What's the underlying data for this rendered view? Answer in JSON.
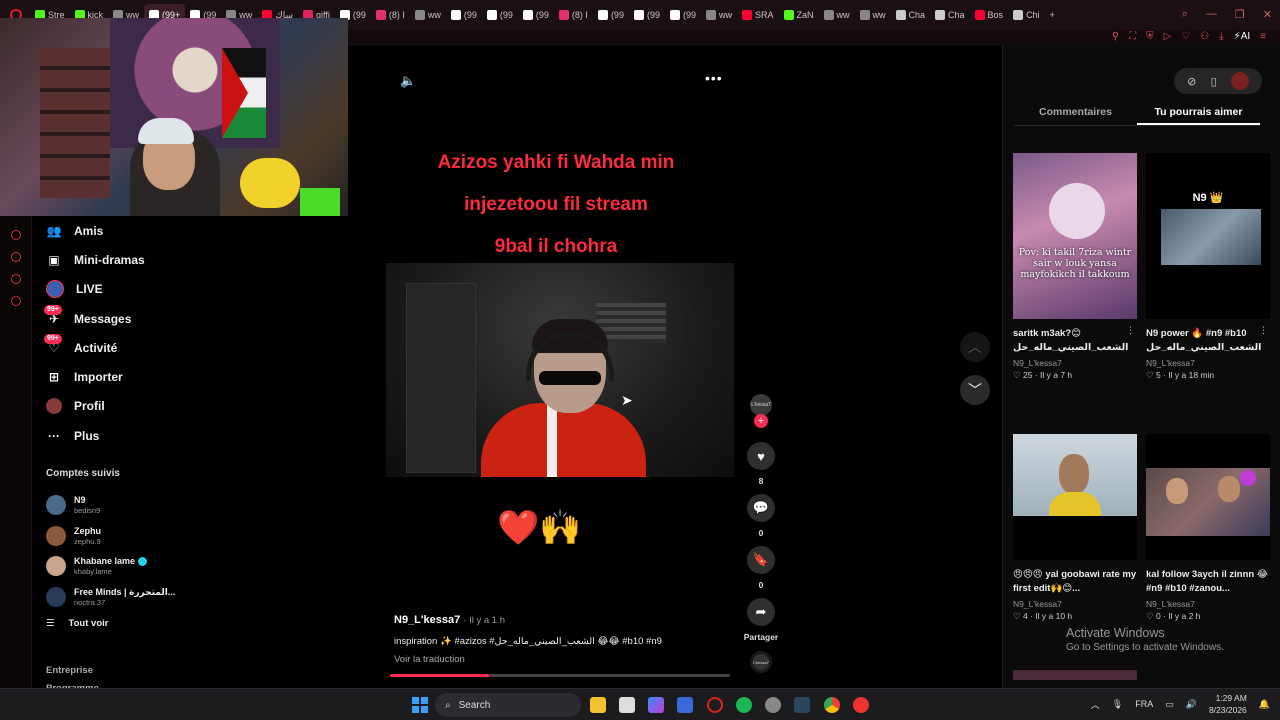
{
  "browser": {
    "tabs": [
      {
        "label": "Stre",
        "color": "#53fc18"
      },
      {
        "label": "kick",
        "color": "#53fc18"
      },
      {
        "label": "ww",
        "color": "#888888"
      },
      {
        "label": "(99+",
        "color": "#ffffff",
        "active": true
      },
      {
        "label": "(99",
        "color": "#ffffff"
      },
      {
        "label": "ww",
        "color": "#888888"
      },
      {
        "label": "ساك",
        "color": "#ff0033"
      },
      {
        "label": "giffi",
        "color": "#e0245e"
      },
      {
        "label": "(99",
        "color": "#ffffff"
      },
      {
        "label": "(8) I",
        "color": "#e1306c"
      },
      {
        "label": "ww",
        "color": "#888888"
      },
      {
        "label": "(99",
        "color": "#ffffff"
      },
      {
        "label": "(99",
        "color": "#ffffff"
      },
      {
        "label": "(99",
        "color": "#ffffff"
      },
      {
        "label": "(8) I",
        "color": "#e1306c"
      },
      {
        "label": "(99",
        "color": "#ffffff"
      },
      {
        "label": "(99",
        "color": "#ffffff"
      },
      {
        "label": "(99",
        "color": "#ffffff"
      },
      {
        "label": "ww",
        "color": "#888888"
      },
      {
        "label": "SRA",
        "color": "#ff0033"
      },
      {
        "label": "ZaN",
        "color": "#53fc18"
      },
      {
        "label": "ww",
        "color": "#888888"
      },
      {
        "label": "ww",
        "color": "#888888"
      },
      {
        "label": "Cha",
        "color": "#cccccc"
      },
      {
        "label": "Cha",
        "color": "#cccccc"
      },
      {
        "label": "Bos",
        "color": "#ff0033"
      },
      {
        "label": "Chi",
        "color": "#cccccc"
      }
    ],
    "new_tab": "+"
  },
  "nav": {
    "items": [
      {
        "label": "Amis",
        "icon": "friends-icon"
      },
      {
        "label": "Mini-dramas",
        "icon": "film-icon"
      },
      {
        "label": "LIVE",
        "icon": "live-icon"
      },
      {
        "label": "Messages",
        "icon": "message-icon",
        "badge": "99+"
      },
      {
        "label": "Activité",
        "icon": "activity-icon",
        "badge": "99+"
      },
      {
        "label": "Importer",
        "icon": "upload-icon"
      },
      {
        "label": "Profil",
        "icon": "profile-icon"
      },
      {
        "label": "Plus",
        "icon": "more-icon"
      }
    ],
    "following_title": "Comptes suivis",
    "following": [
      {
        "name": "N9",
        "handle": "bedisn9",
        "color": "#4a6a8a"
      },
      {
        "name": "Zephu",
        "handle": "zephu.9",
        "color": "#8a5a3a"
      },
      {
        "name": "Khabane lame",
        "handle": "khaby.lame",
        "color": "#c9a48a",
        "verified": true
      },
      {
        "name": "Free Minds | المتحررة...",
        "handle": "noctra.37",
        "color": "#2a3a5a"
      }
    ],
    "see_all": "Tout voir",
    "footer": [
      "Entreprise",
      "Programme"
    ]
  },
  "video": {
    "caption_lines": [
      "Azizos yahki fi Wahda min",
      "injezetoou fil stream",
      "9bal il chohra"
    ],
    "emojis": "❤️🙌",
    "author": "N9_L'kessa7",
    "time": "· Il y a 1 h",
    "description": "inspiration ✨ #azizos #الشعب_الصيني_ماله_حل 😂😂 #b10 #n9",
    "translate": "Voir la traduction",
    "progress": 0.29
  },
  "actions": {
    "avatar_label": "L'kessa7",
    "likes": "8",
    "comments": "0",
    "saves": "0",
    "share": "Partager"
  },
  "panel": {
    "tabs": [
      "Commentaires",
      "Tu pourrais aimer"
    ],
    "active_tab": 1,
    "cards": [
      {
        "title": "saritk m3ak?😊 الشعب_الصيني_ماله_حل😂...#",
        "author": "N9_L'kessa7",
        "likes": "25",
        "time": "Il y a 7 h",
        "thumb_caption": "Pov: ki takil 7riza wintr sair w louk yansa mayfokikch il takkoum"
      },
      {
        "title": "N9 power 🔥 #n9 #b10 الشعب_الصيني_ماله_حل😂...#",
        "author": "N9_L'kessa7",
        "likes": "5",
        "time": "Il y a 18 min",
        "thumb_caption": "N9 👑"
      },
      {
        "title": "😠😠😠 yal goobawi rate my first edit🙌😊...",
        "author": "N9_L'kessa7",
        "likes": "4",
        "time": "Il y a 10 h",
        "thumb_caption": ""
      },
      {
        "title": "kal follow 3aych il zinnn 😂 #n9 #b10 #zanou...",
        "author": "N9_L'kessa7",
        "likes": "0",
        "time": "Il y a 2 h",
        "thumb_caption": ""
      }
    ]
  },
  "watermark": {
    "line1": "Activate Windows",
    "line2": "Go to Settings to activate Windows."
  },
  "taskbar": {
    "search_label": "Search",
    "lang": "FRA",
    "time": "1:29 AM",
    "date": "8/23/2026"
  }
}
